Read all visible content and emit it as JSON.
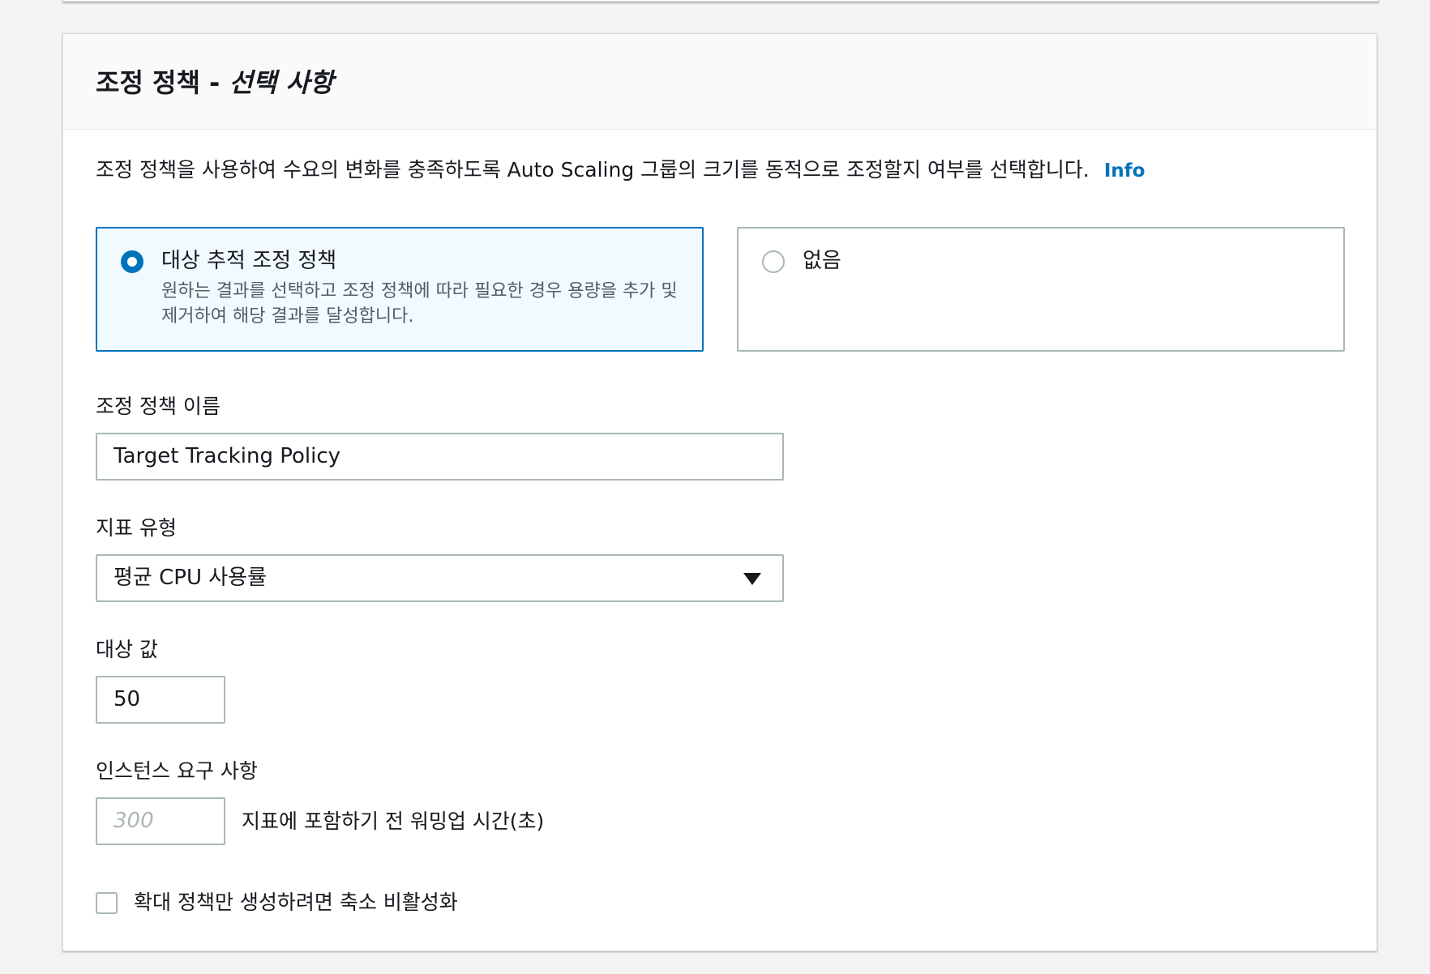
{
  "panel": {
    "title_main": "조정 정책 - ",
    "title_optional": "선택 사항",
    "description": "조정 정책을 사용하여 수요의 변화를 충족하도록 Auto Scaling 그룹의 크기를 동적으로 조정할지 여부를 선택합니다.",
    "info_link": "Info"
  },
  "policy_options": [
    {
      "label": "대상 추적 조정 정책",
      "description": "원하는 결과를 선택하고 조정 정책에 따라 필요한 경우 용량을 추가 및 제거하여 해당 결과를 달성합니다.",
      "selected": true
    },
    {
      "label": "없음",
      "description": "",
      "selected": false
    }
  ],
  "policy_name": {
    "label": "조정 정책 이름",
    "value": "Target Tracking Policy"
  },
  "metric_type": {
    "label": "지표 유형",
    "selected": "평균 CPU 사용률"
  },
  "target_value": {
    "label": "대상 값",
    "value": "50"
  },
  "instance_warmup": {
    "label": "인스턴스 요구 사항",
    "placeholder": "300",
    "suffix": "지표에 포함하기 전 워밍업 시간(초)"
  },
  "disable_scale_in": {
    "label": "확대 정책만 생성하려면 축소 비활성화",
    "checked": false
  },
  "colors": {
    "accent": "#0073bb",
    "selected_tile_bg": "#f1faff",
    "border": "#aab7b8",
    "page_bg": "#f2f3f3"
  }
}
